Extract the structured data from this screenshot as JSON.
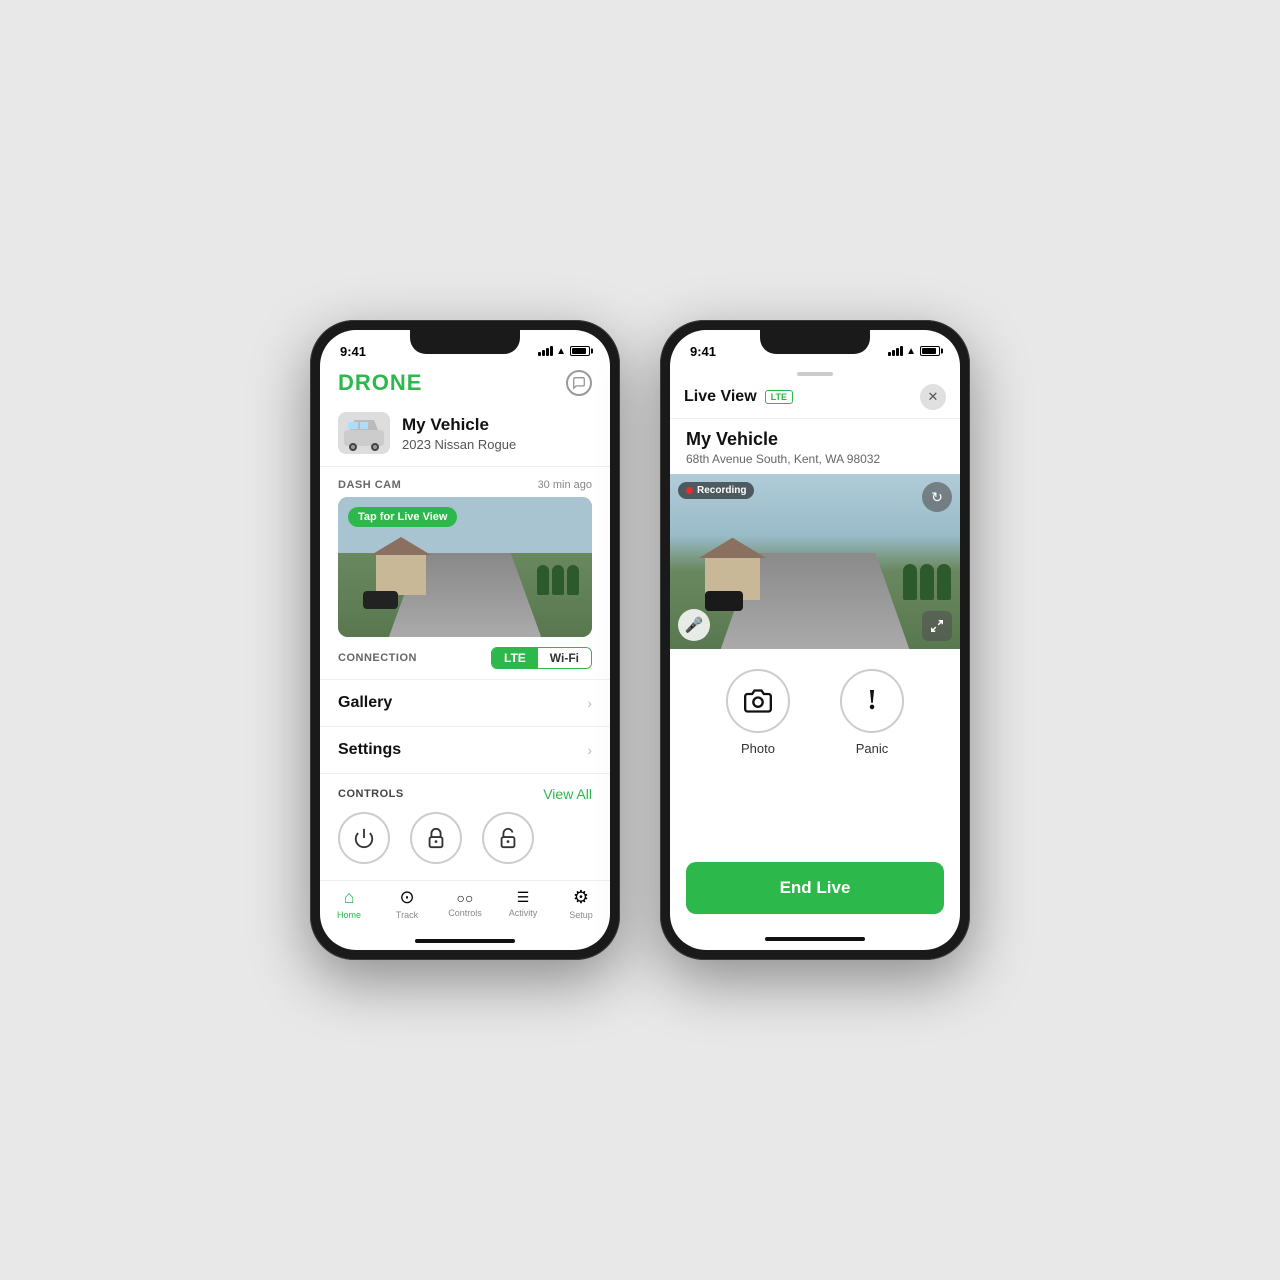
{
  "phone1": {
    "status": {
      "time": "9:41",
      "battery_full": true
    },
    "header": {
      "logo": "DRONE",
      "chat_label": "chat"
    },
    "vehicle": {
      "name": "My Vehicle",
      "model": "2023 Nissan Rogue"
    },
    "dashcam": {
      "section_label": "DASH CAM",
      "timestamp": "30 min ago",
      "live_view_button": "Tap for Live View"
    },
    "connection": {
      "label": "CONNECTION",
      "lte_label": "LTE",
      "wifi_label": "Wi-Fi",
      "active": "LTE"
    },
    "menu": [
      {
        "label": "Gallery"
      },
      {
        "label": "Settings"
      }
    ],
    "controls": {
      "label": "CONTROLS",
      "view_all": "View All"
    },
    "nav": {
      "items": [
        {
          "label": "Home",
          "active": true
        },
        {
          "label": "Track",
          "active": false
        },
        {
          "label": "Controls",
          "active": false
        },
        {
          "label": "Activity",
          "active": false
        },
        {
          "label": "Setup",
          "active": false
        }
      ]
    }
  },
  "phone2": {
    "status": {
      "time": "9:41"
    },
    "live_view": {
      "title": "Live View",
      "badge": "LTE"
    },
    "vehicle": {
      "name": "My Vehicle",
      "address": "68th Avenue South, Kent, WA 98032"
    },
    "camera": {
      "recording_label": "Recording",
      "refresh_icon": "↻",
      "mic_icon": "🎤",
      "expand_icon": "⛶"
    },
    "actions": [
      {
        "label": "Photo",
        "icon": "camera"
      },
      {
        "label": "Panic",
        "icon": "exclamation"
      }
    ],
    "end_live_button": "End Live"
  },
  "colors": {
    "green": "#2db84b",
    "dark": "#111",
    "light_gray": "#f5f5f5",
    "border": "#eee"
  }
}
